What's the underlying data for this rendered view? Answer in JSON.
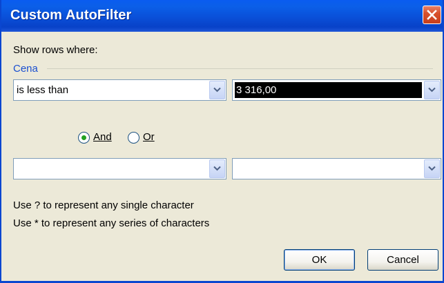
{
  "window": {
    "title": "Custom AutoFilter"
  },
  "prompt": "Show rows where:",
  "group_label": "Cena",
  "condition1": {
    "operator": "is less than",
    "value": "3 316,00"
  },
  "logic": {
    "and_label": "And",
    "or_label": "Or",
    "selected": "And"
  },
  "condition2": {
    "operator": "",
    "value": ""
  },
  "hints": {
    "line1": "Use ? to represent any single character",
    "line2": "Use * to represent any series of characters"
  },
  "buttons": {
    "ok": "OK",
    "cancel": "Cancel"
  },
  "colors": {
    "titlebar": "#0a4fd8",
    "close": "#d9512c",
    "dialog_bg": "#ece9d8",
    "group_label": "#1a4fd0",
    "radio_dot": "#21a121"
  },
  "icons": {
    "close": "close-icon",
    "dropdown": "chevron-down-icon"
  }
}
